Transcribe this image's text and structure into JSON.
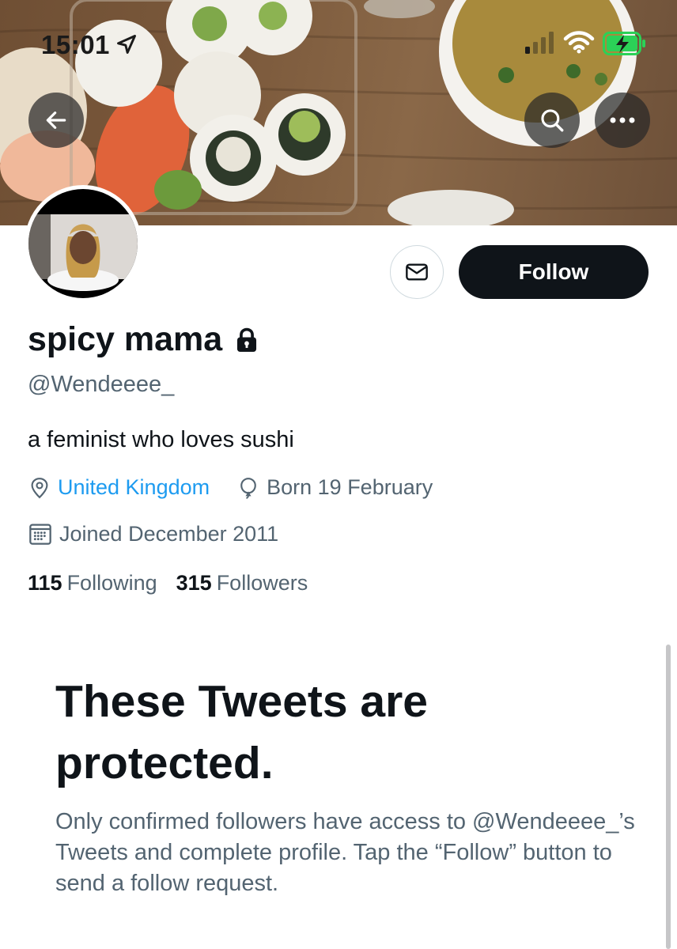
{
  "status_bar": {
    "time": "15:01"
  },
  "profile": {
    "display_name": "spicy mama",
    "handle": "@Wendeeee_",
    "bio": "a feminist who loves sushi",
    "location": "United Kingdom",
    "birthday": "Born 19 February",
    "joined": "Joined December 2011",
    "following_count": "115",
    "following_label": "Following",
    "followers_count": "315",
    "followers_label": "Followers"
  },
  "actions": {
    "follow_label": "Follow"
  },
  "protected": {
    "title": "These Tweets are protected.",
    "description": "Only confirmed followers have access to @Wendeeee_’s Tweets and complete profile. Tap the “Follow” button to send a follow request."
  },
  "icons": {
    "back": "arrow-left-icon",
    "search": "search-icon",
    "more": "more-icon",
    "message": "envelope-icon",
    "lock": "lock-icon",
    "location": "location-pin-icon",
    "birthday": "balloon-icon",
    "joined": "calendar-icon"
  },
  "colors": {
    "accent": "#1d9bf0",
    "text": "#0f1419",
    "secondary": "#536471",
    "button": "#0f1419"
  }
}
